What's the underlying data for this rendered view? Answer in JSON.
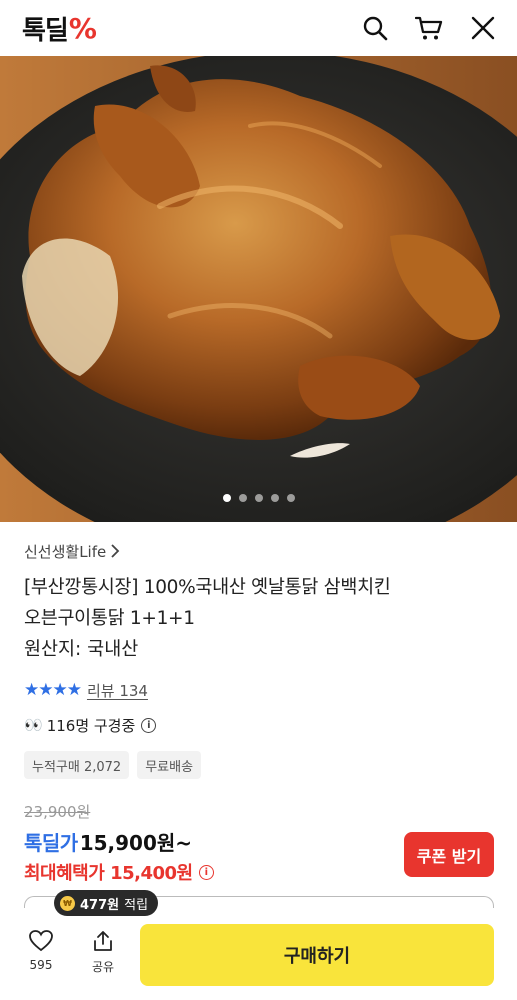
{
  "header": {
    "logo_text": "톡딜",
    "logo_symbol": "%",
    "icons": [
      "search-icon",
      "cart-icon",
      "close-icon"
    ]
  },
  "hero": {
    "image_alt": "roasted whole chicken on black stone plate",
    "slide_count": 5,
    "active_slide": 1
  },
  "product": {
    "seller": "신선생활Life",
    "title_line1": "[부산깡통시장] 100%국내산 옛날통닭 삼백치킨",
    "title_line2": "오븐구이통닭 1+1+1",
    "origin": "원산지: 국내산",
    "rating_stars": 4,
    "review_text": "리뷰 134",
    "viewing_count": "116명 구경중",
    "badges": [
      "누적구매 2,072",
      "무료배송"
    ]
  },
  "price": {
    "original": "23,900원",
    "deal_label": "톡딜가",
    "deal_price": "15,900원~",
    "max_benefit": "최대혜택가 15,400원",
    "coupon_button": "쿠폰 받기"
  },
  "bottom": {
    "like_count": "595",
    "share_label": "공유",
    "points": "477원",
    "points_suffix": "적립",
    "buy_button": "구매하기"
  },
  "colors": {
    "accent_blue": "#2f6fe4",
    "accent_red": "#e8352e",
    "buy_yellow": "#f9e43b"
  }
}
